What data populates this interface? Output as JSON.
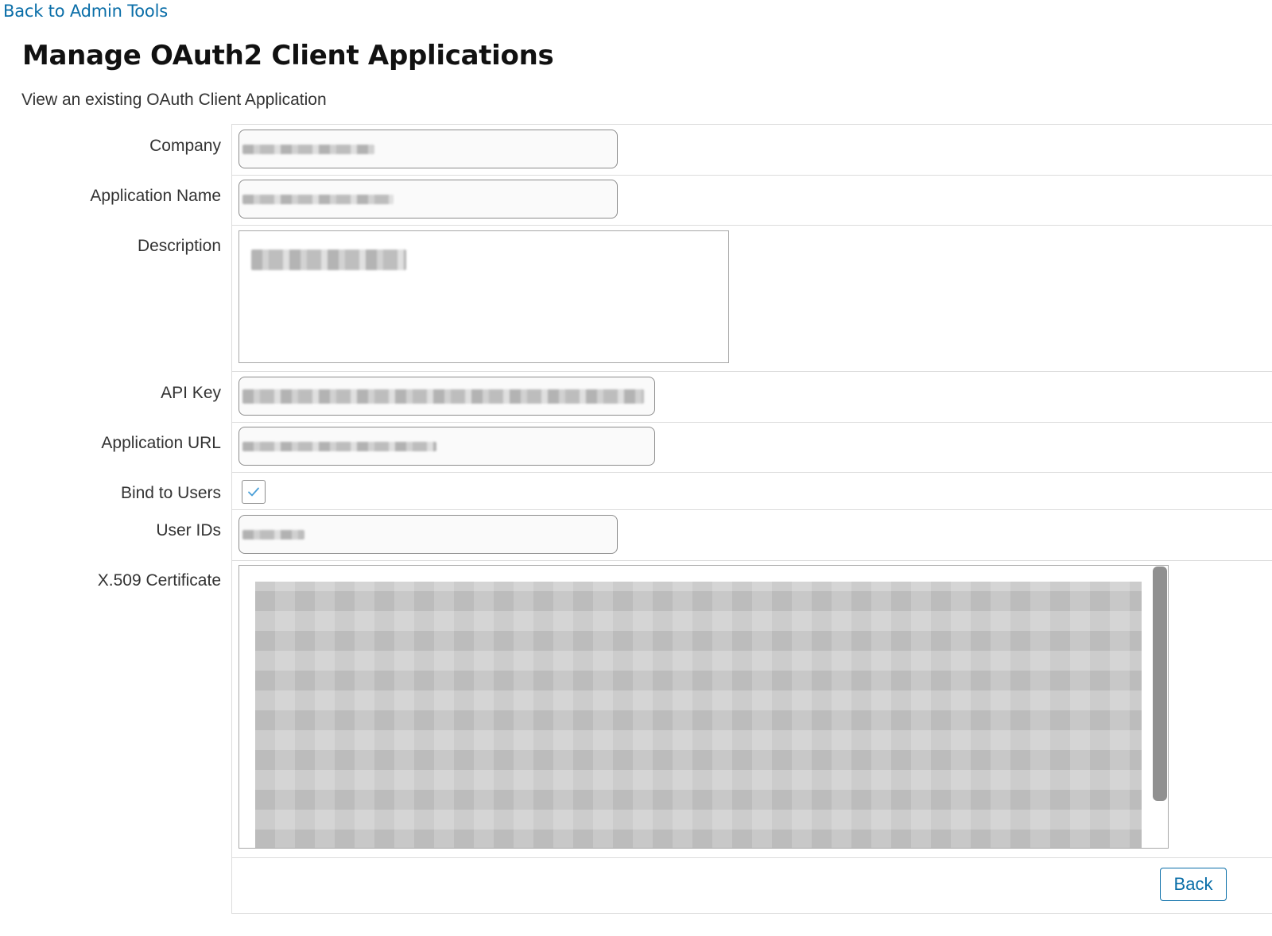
{
  "nav": {
    "back_link": "Back to Admin Tools"
  },
  "page": {
    "title": "Manage OAuth2 Client Applications",
    "subtitle": "View an existing OAuth Client Application"
  },
  "form": {
    "company_label": "Company",
    "app_name_label": "Application Name",
    "description_label": "Description",
    "api_key_label": "API Key",
    "app_url_label": "Application URL",
    "bind_users_label": "Bind to Users",
    "bind_users_checked": true,
    "user_ids_label": "User IDs",
    "certificate_label": "X.509 Certificate"
  },
  "actions": {
    "back_button": "Back"
  },
  "colors": {
    "link": "#0a6ea8",
    "check": "#4a9fd8"
  },
  "icons": {
    "checkbox": "check-icon"
  }
}
